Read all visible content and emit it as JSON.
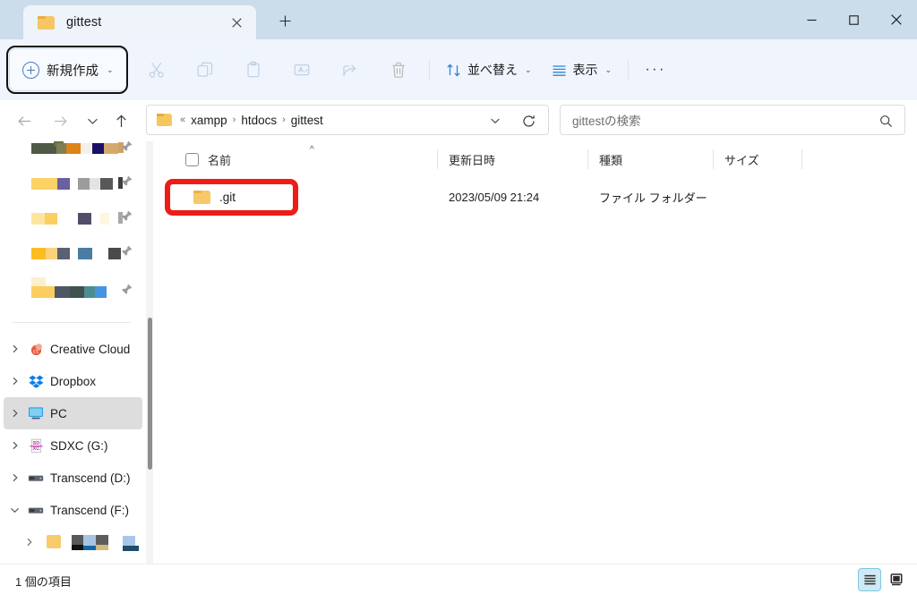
{
  "window": {
    "tab": {
      "title": "gittest",
      "folder_icon": "folder-icon",
      "close_icon": "close-icon"
    },
    "new_tab_label": "+",
    "controls": {
      "minimize": "minimize-icon",
      "maximize": "maximize-icon",
      "close": "close-icon"
    }
  },
  "toolbar": {
    "new_label": "新規作成",
    "new_chevron": "⌄",
    "icons": [
      {
        "name": "cut-icon",
        "label": "切り取り"
      },
      {
        "name": "copy-icon",
        "label": "コピー"
      },
      {
        "name": "paste-icon",
        "label": "貼り付け"
      },
      {
        "name": "rename-icon",
        "label": "名前の変更"
      },
      {
        "name": "share-icon",
        "label": "共有"
      },
      {
        "name": "delete-icon",
        "label": "削除"
      }
    ],
    "sort_label": "並べ替え",
    "view_label": "表示",
    "more_label": "···"
  },
  "address": {
    "back_icon": "back-arrow-icon",
    "forward_icon": "forward-arrow-icon",
    "recent_icon": "chevron-down-icon",
    "up_icon": "up-arrow-icon",
    "prefix": "«",
    "crumbs": [
      "xampp",
      "htdocs",
      "gittest"
    ],
    "separator": "›",
    "dropdown_icon": "chevron-down-icon",
    "refresh_icon": "refresh-icon"
  },
  "search": {
    "placeholder": "gittestの検索",
    "icon": "search-icon"
  },
  "sidebar": {
    "pinned": [
      {
        "label": "",
        "redacted": true,
        "pin": "pin-icon"
      },
      {
        "label": "",
        "redacted": true,
        "pin": "pin-icon"
      },
      {
        "label": "",
        "redacted": true,
        "pin": "pin-icon"
      },
      {
        "label": "",
        "redacted": true,
        "pin": "pin-icon"
      },
      {
        "label": "",
        "redacted": true,
        "pin": "pin-icon"
      }
    ],
    "items": [
      {
        "label": "Creative Cloud",
        "icon": "creative-cloud-icon",
        "expanded": false,
        "selected": false
      },
      {
        "label": "Dropbox",
        "icon": "dropbox-icon",
        "expanded": false,
        "selected": false
      },
      {
        "label": "PC",
        "icon": "pc-icon",
        "expanded": false,
        "selected": true
      },
      {
        "label": "SDXC (G:)",
        "icon": "sd-card-icon",
        "expanded": false,
        "selected": false
      },
      {
        "label": "Transcend (D:)",
        "icon": "drive-icon",
        "expanded": false,
        "selected": false
      },
      {
        "label": "Transcend (F:)",
        "icon": "drive-icon",
        "expanded": true,
        "selected": false
      }
    ]
  },
  "filelist": {
    "columns": [
      {
        "label": "名前",
        "key": "name"
      },
      {
        "label": "更新日時",
        "key": "modified"
      },
      {
        "label": "種類",
        "key": "type"
      },
      {
        "label": "サイズ",
        "key": "size"
      }
    ],
    "sort_indicator": "^",
    "rows": [
      {
        "name": ".git",
        "modified": "2023/05/09 21:24",
        "type": "ファイル フォルダー",
        "size": "",
        "icon": "folder-icon",
        "highlighted": true
      }
    ]
  },
  "statusbar": {
    "count_text": "1 個の項目",
    "views": [
      {
        "name": "details-view",
        "active": true
      },
      {
        "name": "large-icons-view",
        "active": false
      }
    ]
  },
  "colors": {
    "titlebar": "#cbdcea",
    "toolbar": "#f0f4fc",
    "accent_blue": "#4b7bbd",
    "annotation_red": "#ee1b17",
    "selected_row": "#dddddd",
    "view_active": "#cfeaf5"
  }
}
